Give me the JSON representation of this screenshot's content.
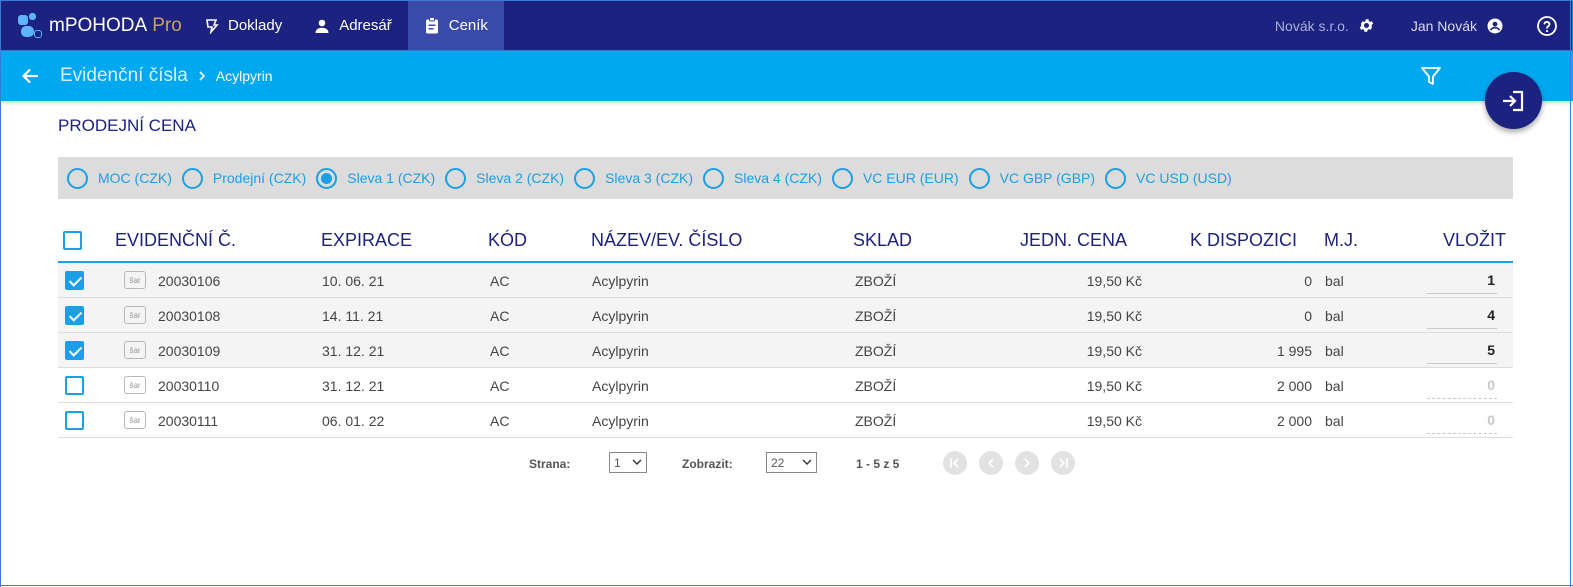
{
  "app": {
    "name": "mPOHODA",
    "edition": "Pro"
  },
  "nav": {
    "items": [
      {
        "label": "Doklady",
        "icon": "documents-icon",
        "active": false
      },
      {
        "label": "Adresář",
        "icon": "person-icon",
        "active": false
      },
      {
        "label": "Ceník",
        "icon": "clipboard-icon",
        "active": true
      }
    ],
    "company": "Novák s.r.o.",
    "user": "Jan Novák"
  },
  "breadcrumb": {
    "main": "Evidenční čísla",
    "current": "Acylpyrin"
  },
  "section": {
    "title": "PRODEJNÍ CENA"
  },
  "price_options": [
    {
      "label": "MOC (CZK)",
      "selected": false
    },
    {
      "label": "Prodejní (CZK)",
      "selected": false
    },
    {
      "label": "Sleva 1 (CZK)",
      "selected": true
    },
    {
      "label": "Sleva 2 (CZK)",
      "selected": false
    },
    {
      "label": "Sleva 3 (CZK)",
      "selected": false
    },
    {
      "label": "Sleva 4 (CZK)",
      "selected": false
    },
    {
      "label": "VC EUR (EUR)",
      "selected": false
    },
    {
      "label": "VC GBP (GBP)",
      "selected": false
    },
    {
      "label": "VC USD (USD)",
      "selected": false
    }
  ],
  "table": {
    "headers": {
      "evid": "EVIDENČNÍ Č.",
      "expirace": "EXPIRACE",
      "kod": "KÓD",
      "nazev": "NÁZEV/EV. ČÍSLO",
      "sklad": "SKLAD",
      "cena": "JEDN. CENA",
      "dispozice": "K DISPOZICI",
      "mj": "M.J.",
      "vlozit": "VLOŽIT"
    },
    "badge_text": "šar",
    "rows": [
      {
        "checked": true,
        "evid": "20030106",
        "expirace": "10. 06. 21",
        "kod": "AC",
        "nazev": "Acylpyrin",
        "sklad": "ZBOŽÍ",
        "cena": "19,50 Kč",
        "dispozice": "0",
        "mj": "bal",
        "vlozit": "1"
      },
      {
        "checked": true,
        "evid": "20030108",
        "expirace": "14. 11. 21",
        "kod": "AC",
        "nazev": "Acylpyrin",
        "sklad": "ZBOŽÍ",
        "cena": "19,50 Kč",
        "dispozice": "0",
        "mj": "bal",
        "vlozit": "4"
      },
      {
        "checked": true,
        "evid": "20030109",
        "expirace": "31. 12. 21",
        "kod": "AC",
        "nazev": "Acylpyrin",
        "sklad": "ZBOŽÍ",
        "cena": "19,50 Kč",
        "dispozice": "1 995",
        "mj": "bal",
        "vlozit": "5"
      },
      {
        "checked": false,
        "evid": "20030110",
        "expirace": "31. 12. 21",
        "kod": "AC",
        "nazev": "Acylpyrin",
        "sklad": "ZBOŽÍ",
        "cena": "19,50 Kč",
        "dispozice": "2 000",
        "mj": "bal",
        "vlozit": "0"
      },
      {
        "checked": false,
        "evid": "20030111",
        "expirace": "06. 01. 22",
        "kod": "AC",
        "nazev": "Acylpyrin",
        "sklad": "ZBOŽÍ",
        "cena": "19,50 Kč",
        "dispozice": "2 000",
        "mj": "bal",
        "vlozit": "0"
      }
    ]
  },
  "pager": {
    "page_label": "Strana:",
    "page_value": "1",
    "show_label": "Zobrazit:",
    "show_value": "22",
    "count_text": "1 - 5 z 5"
  },
  "colors": {
    "navy": "#1c2280",
    "accent": "#00a8f0",
    "link": "#1aa0e6",
    "muted": "#dcdcdc"
  }
}
